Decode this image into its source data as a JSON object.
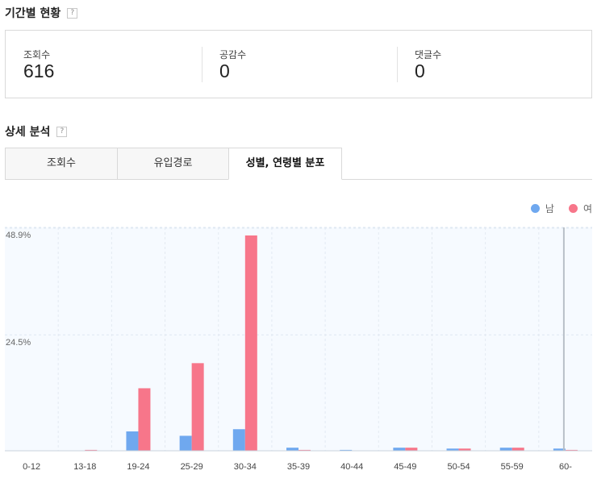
{
  "period": {
    "title": "기간별 현황",
    "help": "?",
    "stats": [
      {
        "label": "조회수",
        "value": "616"
      },
      {
        "label": "공감수",
        "value": "0"
      },
      {
        "label": "댓글수",
        "value": "0"
      }
    ]
  },
  "detail": {
    "title": "상세 분석",
    "help": "?",
    "tabs": [
      {
        "label": "조회수",
        "active": false
      },
      {
        "label": "유입경로",
        "active": false
      },
      {
        "label": "성별, 연령별 분포",
        "active": true
      }
    ]
  },
  "legend": [
    {
      "name": "남",
      "color": "#6fa8ef"
    },
    {
      "name": "여",
      "color": "#f7768a"
    }
  ],
  "chart_data": {
    "type": "bar",
    "categories": [
      "0-12",
      "13-18",
      "19-24",
      "25-29",
      "30-34",
      "35-39",
      "40-44",
      "45-49",
      "50-54",
      "55-59",
      "60-"
    ],
    "series": [
      {
        "name": "남",
        "color": "#6fa8ef",
        "values": [
          0,
          0,
          4.4,
          3.4,
          4.9,
          0.7,
          0.2,
          0.7,
          0.5,
          0.7,
          0.5
        ]
      },
      {
        "name": "여",
        "color": "#f7768a",
        "values": [
          0,
          0.2,
          14.2,
          19.9,
          48.9,
          0.2,
          0,
          0.7,
          0.5,
          0.7,
          0.2
        ]
      }
    ],
    "yticks": [
      "48.9%",
      "24.5%"
    ],
    "ytick_values": [
      48.9,
      24.5
    ],
    "ylim": [
      0,
      48.9
    ],
    "grid": true
  }
}
